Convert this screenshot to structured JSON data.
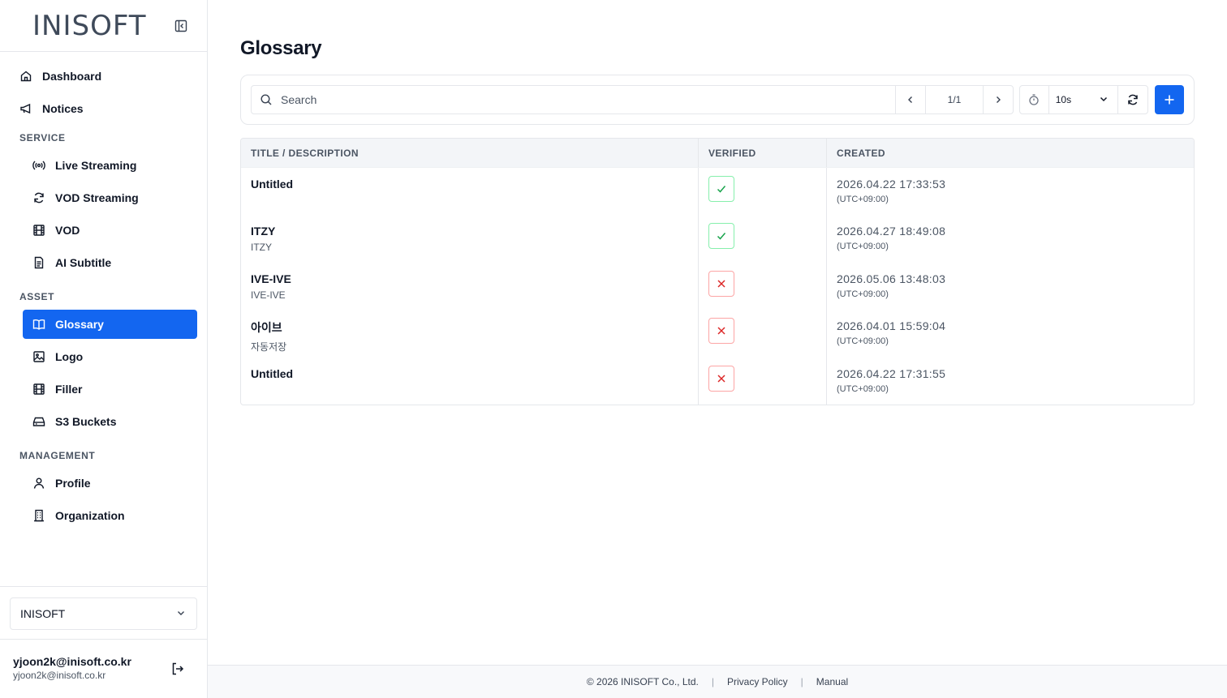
{
  "brand": {
    "name": "INISOFT"
  },
  "sidebar": {
    "top_items": [
      {
        "label": "Dashboard",
        "icon": "home-icon"
      },
      {
        "label": "Notices",
        "icon": "megaphone-icon"
      }
    ],
    "sections": [
      {
        "label": "SERVICE",
        "items": [
          {
            "label": "Live Streaming",
            "icon": "broadcast-icon"
          },
          {
            "label": "VOD Streaming",
            "icon": "refresh-icon"
          },
          {
            "label": "VOD",
            "icon": "film-icon"
          },
          {
            "label": "AI Subtitle",
            "icon": "document-icon"
          }
        ]
      },
      {
        "label": "ASSET",
        "items": [
          {
            "label": "Glossary",
            "icon": "book-icon",
            "active": true
          },
          {
            "label": "Logo",
            "icon": "image-icon"
          },
          {
            "label": "Filler",
            "icon": "film-icon"
          },
          {
            "label": "S3 Buckets",
            "icon": "drive-icon"
          }
        ]
      },
      {
        "label": "MANAGEMENT",
        "items": [
          {
            "label": "Profile",
            "icon": "user-icon"
          },
          {
            "label": "Organization",
            "icon": "building-icon"
          }
        ]
      }
    ],
    "organization": "INISOFT",
    "user": {
      "name": "yjoon2k@inisoft.co.kr",
      "email": "yjoon2k@inisoft.co.kr"
    }
  },
  "main": {
    "title": "Glossary",
    "search_placeholder": "Search",
    "pager": "1/1",
    "interval": "10s",
    "columns": [
      "TITLE / DESCRIPTION",
      "VERIFIED",
      "CREATED"
    ],
    "rows": [
      {
        "title": "Untitled",
        "description": "",
        "verified": true,
        "created": "2026.04.22 17:33:53",
        "tz": "(UTC+09:00)"
      },
      {
        "title": "ITZY",
        "description": "ITZY",
        "verified": true,
        "created": "2026.04.27 18:49:08",
        "tz": "(UTC+09:00)"
      },
      {
        "title": "IVE-IVE",
        "description": "IVE-IVE",
        "verified": false,
        "created": "2026.05.06 13:48:03",
        "tz": "(UTC+09:00)"
      },
      {
        "title": "아이브",
        "description": "자동저장",
        "verified": false,
        "created": "2026.04.01 15:59:04",
        "tz": "(UTC+09:00)"
      },
      {
        "title": "Untitled",
        "description": "",
        "verified": false,
        "created": "2026.04.22 17:31:55",
        "tz": "(UTC+09:00)"
      }
    ]
  },
  "footer": {
    "copyright": "© 2026 INISOFT Co., Ltd.",
    "privacy": "Privacy Policy",
    "manual": "Manual"
  },
  "colors": {
    "accent": "#1366f0",
    "verified_ok": "#16a34a",
    "verified_no": "#dc2626"
  }
}
